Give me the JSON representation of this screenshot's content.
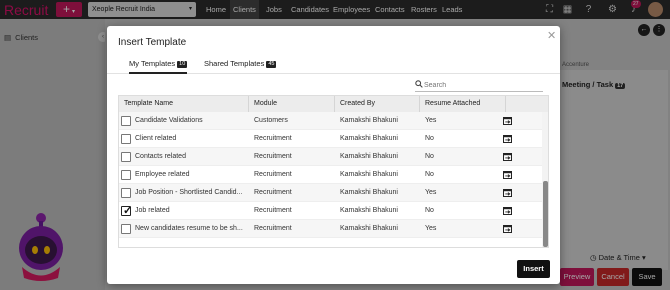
{
  "app": {
    "brand": "Recruit",
    "org_select": "Xeople Recruit India",
    "nav": [
      "Home",
      "Clients",
      "Jobs",
      "Candidates",
      "Employees",
      "Contacts",
      "Rosters",
      "Leads"
    ],
    "active_nav": "Clients",
    "notification_count": "27",
    "sidebar_title": "Clients",
    "right_panel_tab": "Meeting / Task",
    "right_panel_tab_count": "17",
    "right_panel_caption": "Accenture",
    "date_time_label": "Date & Time",
    "buttons": {
      "preview": "Preview",
      "cancel": "Cancel",
      "save": "Save"
    },
    "colors": {
      "brand": "#d9126b",
      "nav_bg": "#2b2b2b",
      "cancel": "#c62828",
      "preview": "#c2185b",
      "save": "#111111"
    }
  },
  "modal": {
    "title": "Insert Template",
    "close_icon": "close-icon",
    "tabs": [
      {
        "label": "My Templates",
        "count": "10"
      },
      {
        "label": "Shared Templates",
        "count": "45"
      }
    ],
    "active_tab": "My Templates",
    "search": {
      "placeholder": "Search",
      "value": ""
    },
    "columns": [
      "Template Name",
      "Module",
      "Created By",
      "Resume Attached",
      ""
    ],
    "rows": [
      {
        "name": "Candidate Validations",
        "module": "Customers",
        "created_by": "Kamakshi Bhakuni",
        "resume": "Yes",
        "checked": false
      },
      {
        "name": "Client related",
        "module": "Recruitment",
        "created_by": "Kamakshi Bhakuni",
        "resume": "No",
        "checked": false
      },
      {
        "name": "Contacts related",
        "module": "Recruitment",
        "created_by": "Kamakshi Bhakuni",
        "resume": "No",
        "checked": false
      },
      {
        "name": "Employee related",
        "module": "Recruitment",
        "created_by": "Kamakshi Bhakuni",
        "resume": "No",
        "checked": false
      },
      {
        "name": "Job Position - Shortlisted Candid...",
        "module": "Recruitment",
        "created_by": "Kamakshi Bhakuni",
        "resume": "Yes",
        "checked": false
      },
      {
        "name": "Job related",
        "module": "Recruitment",
        "created_by": "Kamakshi Bhakuni",
        "resume": "No",
        "checked": true
      },
      {
        "name": "New candidates resume to be sh...",
        "module": "Recruitment",
        "created_by": "Kamakshi Bhakuni",
        "resume": "Yes",
        "checked": false
      }
    ],
    "row_action_icon": "preview-template-icon",
    "insert_label": "Insert"
  }
}
